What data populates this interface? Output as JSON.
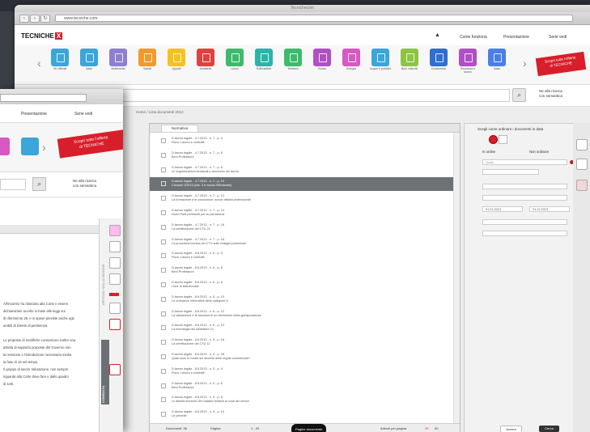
{
  "browser": {
    "url": "www.tecniche.com",
    "window_title": "Tecnichecom"
  },
  "site": {
    "logo_text": "TECNICHE",
    "logo_mark": "X",
    "top_links": [
      "Come funziona",
      "Presentazione",
      "Serie vedi"
    ],
    "adv_search": "Ne alla ricerca\ncon semantica",
    "promo_text": "Scopri tutte l'offerte\ndi TECNICHE",
    "breadcrumb": "Home / Lista documenti 2013"
  },
  "tiles": [
    {
      "label": "Gli Ufficiali",
      "color": "#3aa6d9"
    },
    {
      "label": "Varie",
      "color": "#3aa6d9"
    },
    {
      "label": "Multimedia",
      "color": "#8e7fd1"
    },
    {
      "label": "Sanità",
      "color": "#f19a2a"
    },
    {
      "label": "Appalti",
      "color": "#f5c21d"
    },
    {
      "label": "Ambiente",
      "color": "#e04040"
    },
    {
      "label": "Lavori",
      "color": "#3dbb6c"
    },
    {
      "label": "Edificabilità",
      "color": "#2ab5a8"
    },
    {
      "label": "Territorio",
      "color": "#3dbb6c"
    },
    {
      "label": "Borsa",
      "color": "#b04fc6"
    },
    {
      "label": "Energia",
      "color": "#d958c1"
    },
    {
      "label": "Acque e pubblici",
      "color": "#3aa6d9"
    },
    {
      "label": "Beni culturali",
      "color": "#8dc443"
    },
    {
      "label": "Condominio",
      "color": "#2f6fd1"
    },
    {
      "label": "Sicurezza e lavoro",
      "color": "#b04fc6"
    },
    {
      "label": "Mass",
      "color": "#4a7ee8"
    }
  ],
  "list": {
    "tab_label": "Normativa",
    "rows": [
      {
        "t1": "D.lavoro legale - 4.7.2013 - n. 7 - p. 4",
        "t2": "Fisco, Lavoro e contratti"
      },
      {
        "t1": "D.lavoro legale - 4.7.2013 - n. 7 - p. 6",
        "t2": "Beni Professioni"
      },
      {
        "t1": "D.lavoro legale - 4.7.2013 - n. 7 - p. 8",
        "t2": "Le organizzazioni sindacali e sicurezza nel lavoro"
      },
      {
        "t1": "D.lavoro legale - 4.7.2013 - n. 7 - p. 10",
        "t2": "Circolari 1/2013 (circ. 3 e nuova 4/Emanato)",
        "sel": true
      },
      {
        "t1": "D.lavoro legale - 4.7.2013 - n. 7 - p. 12",
        "t2": "La formazione e le conclusioni: nuove attività professionali"
      },
      {
        "t1": "D.lavoro legale - 4.7.2013 - n. 7 - p. 14",
        "t2": "Nuovi Patti pertinenti per la previdenza"
      },
      {
        "t1": "D.lavoro legale - 4.7.2013 - n. 7 - p. 16",
        "t2": "La certificazione dei CTU 22"
      },
      {
        "t1": "D.lavoro legale - 4.7.2013 - n. 7 - p. 18",
        "t2": "La procedura tecnica dei CTU sulle indagini preliminari"
      },
      {
        "t1": "D.lavoro legale - 8.6.2013 - n. 6 - p. 4",
        "t2": "Fisco, Lavoro e contratti"
      },
      {
        "t1": "D.lavoro legale - 8.6.2013 - n. 6 - p. 6",
        "t2": "Beni Professioni"
      },
      {
        "t1": "D.lavoro legale - 8.6.2013 - n. 6 - p. 8",
        "t2": "I tour di istituzionale"
      },
      {
        "t1": "D.lavoro legale - 8.6.2013 - n. 6 - p. 10",
        "t2": "Le ordinanze interruttive delle categorie 8"
      },
      {
        "t1": "D.lavoro legale - 8.6.2013 - n. 6 - p. 12",
        "t2": "La valutazione e la funzione di un riferimento della giurisprudenza"
      },
      {
        "t1": "D.lavoro legale - 8.6.2013 - n. 6 - p. 14",
        "t2": "La tecnologia del mediatore 21"
      },
      {
        "t1": "D.lavoro legale - 8.6.2013 - n. 6 - p. 16",
        "t2": "La certificazione dei CTU 11"
      },
      {
        "t1": "D.lavoro legale - 8.6.2013 - n. 6 - p. 18",
        "t2": "Quali sono le novità sul decreto delle regole commerciali?"
      },
      {
        "t1": "D.lavoro legale - 8.5.2013 - n. 5 - p. 4",
        "t2": "Fisco, Lavoro e contratti"
      },
      {
        "t1": "D.lavoro legale - 8.5.2013 - n. 5 - p. 6",
        "t2": "Beni Professioni"
      },
      {
        "t1": "D.lavoro legale - 8.5.2013 - n. 5 - p. 8",
        "t2": "Le attività tecniche del Catasto relative ai costi dei servizi"
      },
      {
        "t1": "D.lavoro legale - 8.5.2013 - n. 5 - p. 10",
        "t2": "Le parcelle"
      }
    ],
    "footer_docs": "Documenti: 36",
    "footer_page": "Pagina",
    "footer_range": "1 - 20",
    "footer_pill": "Pagine documento",
    "footer_per_page": "Articoli per pagina"
  },
  "filters": {
    "title": "Scegli come ordinare i documenti in data",
    "opt1": "In ordine",
    "opt2": "Non ordinare",
    "field_placeholder": "Quale",
    "date_from": "01.01.2013",
    "date_to": "31.12.2013",
    "btn_reset": "Azzera",
    "btn_search": "Cerca"
  },
  "front": {
    "links": [
      "Presentazione",
      "Serie vedi"
    ],
    "promo_text": "Scopri tutte l'offerte\ndi TECNICHE",
    "adv_search": "Ne alla ricerca\ncon semantica",
    "side_labels": [
      "ARTICOLI NELLA SEZIONE",
      "CONSULTA"
    ],
    "paragraphs": [
      "All'incontro ha rilasciato alla Corte e essere",
      "dichiarazioni accolte in base alle leggi sui",
      "di riferimento 29, e in spese previste anche agli",
      "ambiti di Dirette di pertinenza.",
      "",
      "Le proposte di modifiche consentono inoltre una",
      "attività di supporto proposte del Governo non",
      "la revisione o l'introduzione necessaria media",
      "la fase di 16 nel tempo.",
      "Il gruppo di lavoro Valutazione, non sempre",
      "riguarda alla Corte dove fare e dallo quadro",
      "di sorti."
    ]
  }
}
